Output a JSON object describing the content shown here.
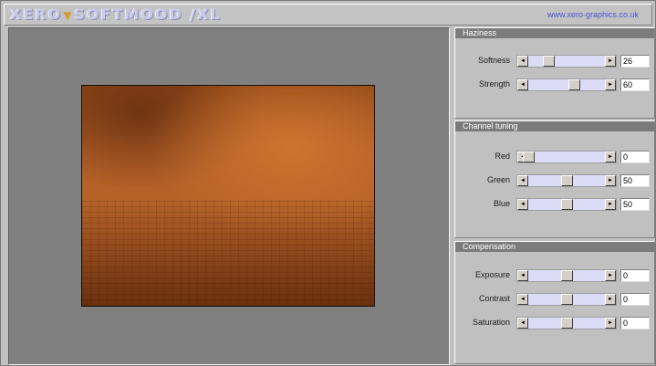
{
  "header": {
    "logo": "XERO",
    "logo_tail": "SOFTMOOD /XL",
    "logo_triangle": "▼",
    "website": "www.xero-graphics.co.uk"
  },
  "panels": {
    "haziness": {
      "title": "Haziness",
      "rows": [
        {
          "label": "Softness",
          "value": "26",
          "level": 0.26
        },
        {
          "label": "Strength",
          "value": "60",
          "level": 0.6
        }
      ]
    },
    "channel_tuning": {
      "title": "Channel tuning",
      "rows": [
        {
          "label": "Red",
          "value": "0",
          "level": 0.0
        },
        {
          "label": "Green",
          "value": "50",
          "level": 0.5
        },
        {
          "label": "Blue",
          "value": "50",
          "level": 0.5
        }
      ]
    },
    "compensation": {
      "title": "Compensation",
      "rows": [
        {
          "label": "Exposure",
          "value": "0",
          "level": 0.5
        },
        {
          "label": "Contrast",
          "value": "0",
          "level": 0.5
        },
        {
          "label": "Saturation",
          "value": "0",
          "level": 0.5
        }
      ]
    }
  },
  "icons": {
    "arrow_left": "◄",
    "arrow_right": "►"
  }
}
